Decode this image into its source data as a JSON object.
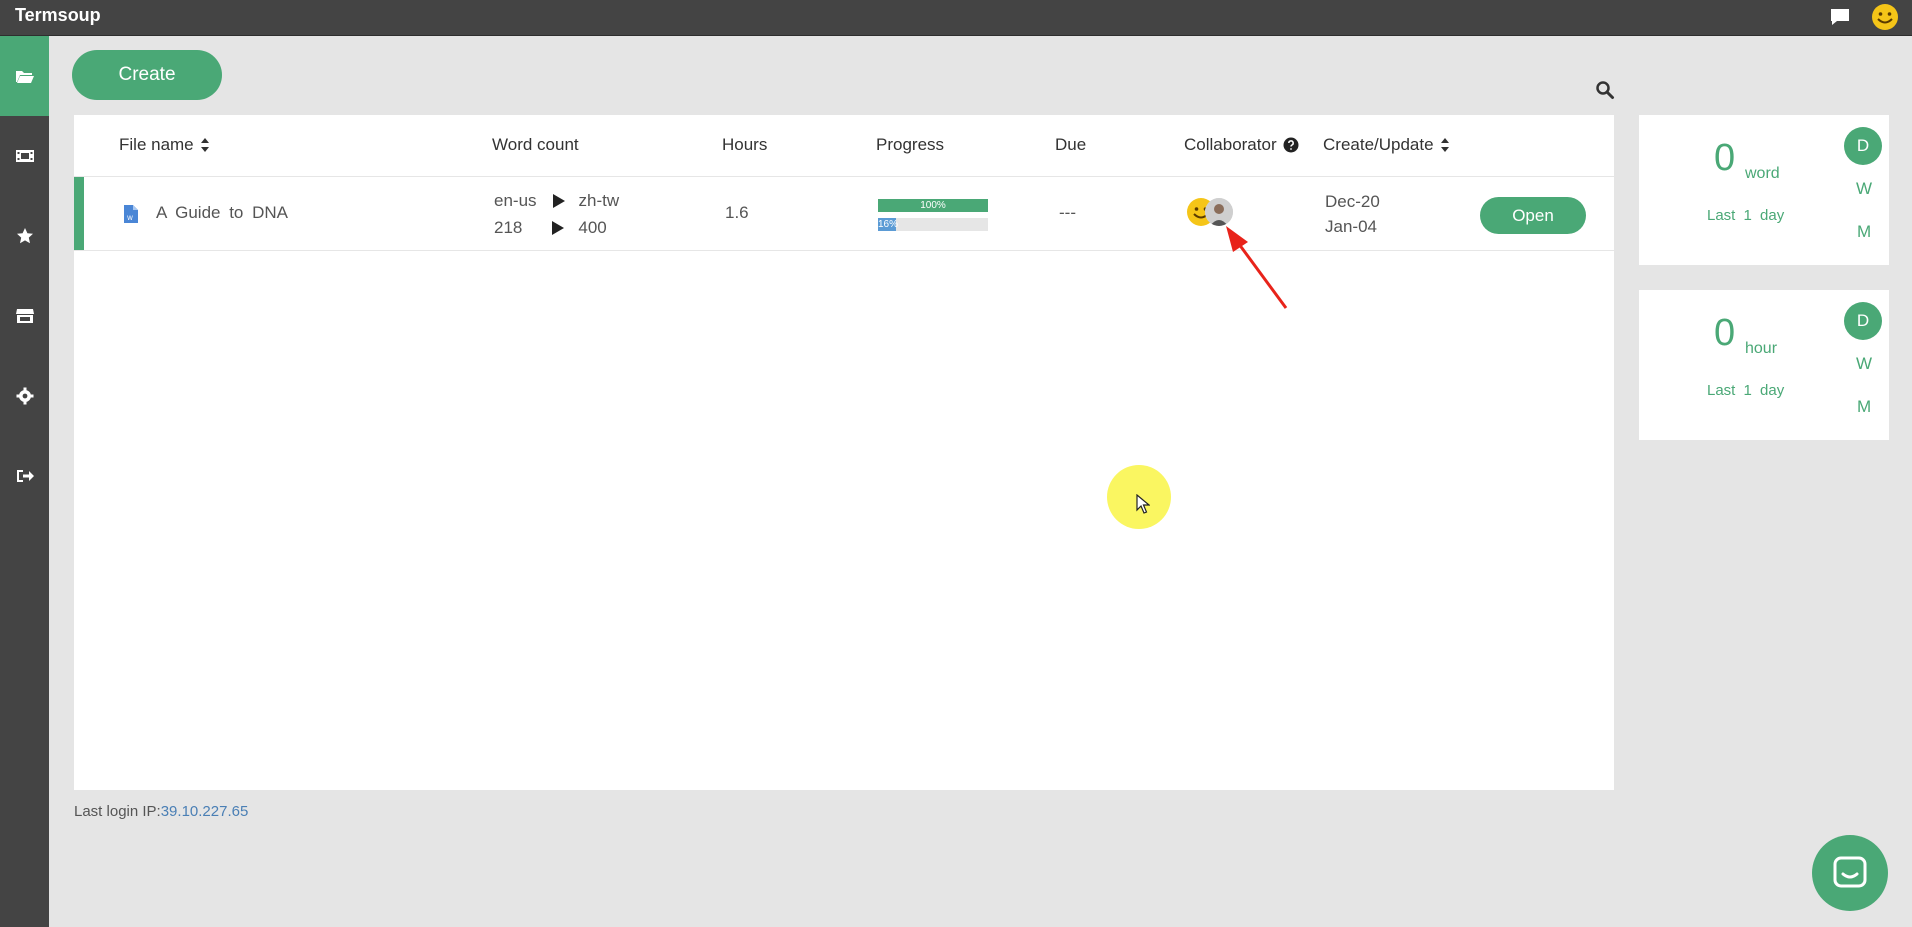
{
  "app": {
    "title": "Termsoup"
  },
  "toolbar": {
    "create_label": "Create"
  },
  "table": {
    "headers": {
      "file_name": "File name",
      "word_count": "Word count",
      "hours": "Hours",
      "progress": "Progress",
      "due": "Due",
      "collaborator": "Collaborator",
      "create_update": "Create/Update"
    },
    "rows": [
      {
        "file_name": "A Guide to DNA",
        "source_lang": "en-us",
        "target_lang": "zh-tw",
        "source_words": "218",
        "target_words": "400",
        "hours": "1.6",
        "progress_primary": {
          "label": "100%",
          "value": 100
        },
        "progress_secondary": {
          "label": "16%",
          "value": 16
        },
        "due": "---",
        "created": "Dec-20",
        "updated": "Jan-04",
        "open_label": "Open"
      }
    ]
  },
  "footer": {
    "last_login_label": "Last login IP:",
    "ip": "39.10.227.65"
  },
  "stats": [
    {
      "value": "0",
      "unit": "word",
      "period": "Last 1 day",
      "tabs": [
        "D",
        "W",
        "M"
      ]
    },
    {
      "value": "0",
      "unit": "hour",
      "period": "Last 1 day",
      "tabs": [
        "D",
        "W",
        "M"
      ]
    }
  ],
  "colors": {
    "accent": "#4aa876",
    "topbar": "#444444",
    "background": "#e5e5e5",
    "link": "#4a7fb5",
    "annotation": "#e8231a"
  }
}
